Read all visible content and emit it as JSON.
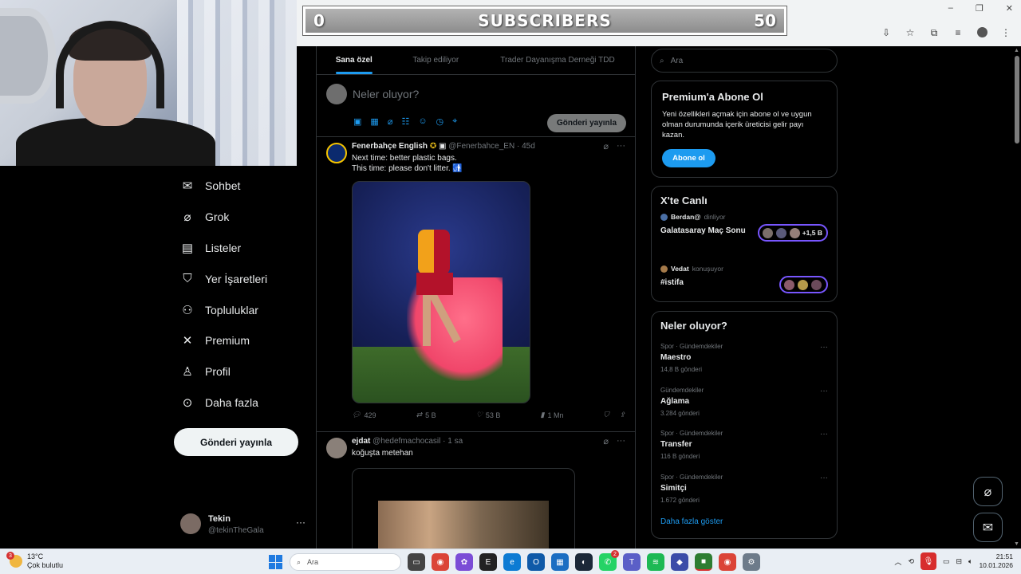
{
  "overlay": {
    "left_count": "0",
    "title": "SUBSCRIBERS",
    "right_count": "50"
  },
  "window_controls": {
    "minimize": "–",
    "restore": "❐",
    "close": "✕"
  },
  "nav": {
    "items": [
      {
        "label": "Sohbet",
        "icon": "mail-icon",
        "glyph": "✉"
      },
      {
        "label": "Grok",
        "icon": "grok-icon",
        "glyph": "⌀"
      },
      {
        "label": "Listeler",
        "icon": "list-icon",
        "glyph": "▤"
      },
      {
        "label": "Yer İşaretleri",
        "icon": "bookmark-icon",
        "glyph": "⛉"
      },
      {
        "label": "Topluluklar",
        "icon": "communities-icon",
        "glyph": "👥"
      },
      {
        "label": "Premium",
        "icon": "x-logo-icon",
        "glyph": "𝕏"
      },
      {
        "label": "Profil",
        "icon": "profile-icon",
        "glyph": "👤"
      },
      {
        "label": "Daha fazla",
        "icon": "more-circle-icon",
        "glyph": "⋯"
      }
    ],
    "post_button": "Gönderi yayınla",
    "account": {
      "name": "Tekin",
      "handle": "@tekinTheGala"
    }
  },
  "feed": {
    "tabs": [
      {
        "label": "Sana özel",
        "active": true
      },
      {
        "label": "Takip ediliyor",
        "active": false
      },
      {
        "label": "Trader Dayanışma Derneği TDD",
        "active": false
      }
    ],
    "compose": {
      "placeholder": "Neler oluyor?",
      "post_button": "Gönderi yayınla"
    },
    "tweets": [
      {
        "name": "Fenerbahçe English",
        "handle": "@Fenerbahce_EN",
        "time": "45d",
        "text": "Next time: better plastic bags.\nThis time: please don't litter. 🚮",
        "replies": "429",
        "retweets": "5 B",
        "likes": "53 B",
        "views": "1 Mn"
      },
      {
        "name": "ejdat",
        "handle": "@hedefmachocasil",
        "time": "1 sa",
        "text": "koğuşta metehan"
      }
    ]
  },
  "right": {
    "search_placeholder": "Ara",
    "premium": {
      "title": "Premium'a Abone Ol",
      "text": "Yeni özellikleri açmak için abone ol ve uygun olman durumunda içerik üreticisi gelir payı kazan.",
      "button": "Abone ol"
    },
    "live": {
      "title": "X'te Canlı",
      "items": [
        {
          "user": "Berdan@",
          "status": "dinliyor",
          "title": "Galatasaray Maç Sonu",
          "extra": "+1,5 B"
        },
        {
          "user": "Vedat",
          "status": "konuşuyor",
          "title": "#istifa",
          "extra": ""
        }
      ]
    },
    "trends": {
      "title": "Neler oluyor?",
      "items": [
        {
          "category": "Spor · Gündemdekiler",
          "name": "Maestro",
          "count": "14,8 B gönderi"
        },
        {
          "category": "Gündemdekiler",
          "name": "Ağlama",
          "count": "3.284 gönderi"
        },
        {
          "category": "Spor · Gündemdekiler",
          "name": "Transfer",
          "count": "116 B gönderi"
        },
        {
          "category": "Spor · Gündemdekiler",
          "name": "Simitçi",
          "count": "1.672 gönderi"
        }
      ],
      "show_more": "Daha fazla göster"
    }
  },
  "taskbar": {
    "weather_temp": "13°C",
    "weather_desc": "Çok bulutlu",
    "weather_badge": "3",
    "search_placeholder": "Ara",
    "whatsapp_badge": "2",
    "time": "21:51",
    "date": "10.01.2026"
  },
  "colors": {
    "accent": "#1d9bf0",
    "live_border": "#7856ff",
    "background": "#000000",
    "recording": "#d72d2d"
  }
}
